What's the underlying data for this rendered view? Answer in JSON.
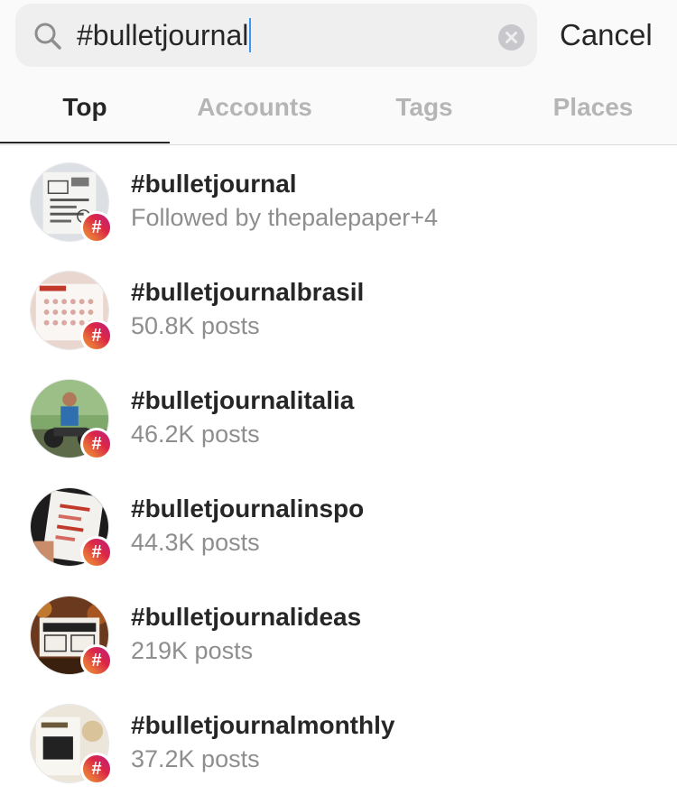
{
  "search": {
    "query": "#bulletjournal",
    "cancel_label": "Cancel"
  },
  "tabs": [
    {
      "label": "Top",
      "active": true
    },
    {
      "label": "Accounts",
      "active": false
    },
    {
      "label": "Tags",
      "active": false
    },
    {
      "label": "Places",
      "active": false
    }
  ],
  "results": [
    {
      "title": "#bulletjournal",
      "subtitle": "Followed by thepalepaper+4",
      "badge": "#"
    },
    {
      "title": "#bulletjournalbrasil",
      "subtitle": "50.8K posts",
      "badge": "#"
    },
    {
      "title": "#bulletjournalitalia",
      "subtitle": "46.2K posts",
      "badge": "#"
    },
    {
      "title": "#bulletjournalinspo",
      "subtitle": "44.3K posts",
      "badge": "#"
    },
    {
      "title": "#bulletjournalideas",
      "subtitle": "219K posts",
      "badge": "#"
    },
    {
      "title": "#bulletjournalmonthly",
      "subtitle": "37.2K posts",
      "badge": "#"
    }
  ],
  "colors": {
    "accent_gradient_start": "#f09433",
    "accent_gradient_end": "#bc1888",
    "caret": "#3897f0",
    "muted_text": "#8e8e8e"
  }
}
